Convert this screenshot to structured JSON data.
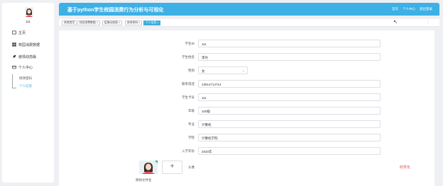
{
  "sidebar": {
    "user_name": "111",
    "items": [
      {
        "label": "主页"
      },
      {
        "label": "校园消费数据"
      },
      {
        "label": "疫情动态版"
      },
      {
        "label": "个人中心"
      }
    ],
    "sub_items": [
      {
        "label": "修改密码"
      },
      {
        "label": "个人信息"
      }
    ]
  },
  "header": {
    "title": "基于python学生校园消费行为分析与可视化",
    "links": [
      "首页",
      "个人中心",
      "退出登录"
    ]
  },
  "tabs": [
    {
      "label": "系统首页"
    },
    {
      "label": "校园消费数据 ×"
    },
    {
      "label": "疫情动态版 ×"
    },
    {
      "label": "修改密码 ×"
    },
    {
      "label": "个人信息 ×"
    }
  ],
  "form": {
    "fields": [
      {
        "label": "学生ID",
        "value": "111"
      },
      {
        "label": "学生姓名",
        "value": "李丹"
      },
      {
        "label": "性别",
        "value": "女"
      },
      {
        "label": "联系电话",
        "value": "13614714714"
      },
      {
        "label": "学生卡号",
        "value": "111"
      },
      {
        "label": "年级",
        "value": "100级"
      },
      {
        "label": "专业",
        "value": "计算机"
      },
      {
        "label": "学院",
        "value": "计算机学院"
      },
      {
        "label": "入学年份",
        "value": "2020年"
      }
    ],
    "photo_label": "头像",
    "upload_icon": "+",
    "remove_label": "移除文件名",
    "role": "的学长"
  },
  "colors": {
    "header": "#3db0e5",
    "accent": "#3aaee0",
    "role": "#e54b4b"
  }
}
